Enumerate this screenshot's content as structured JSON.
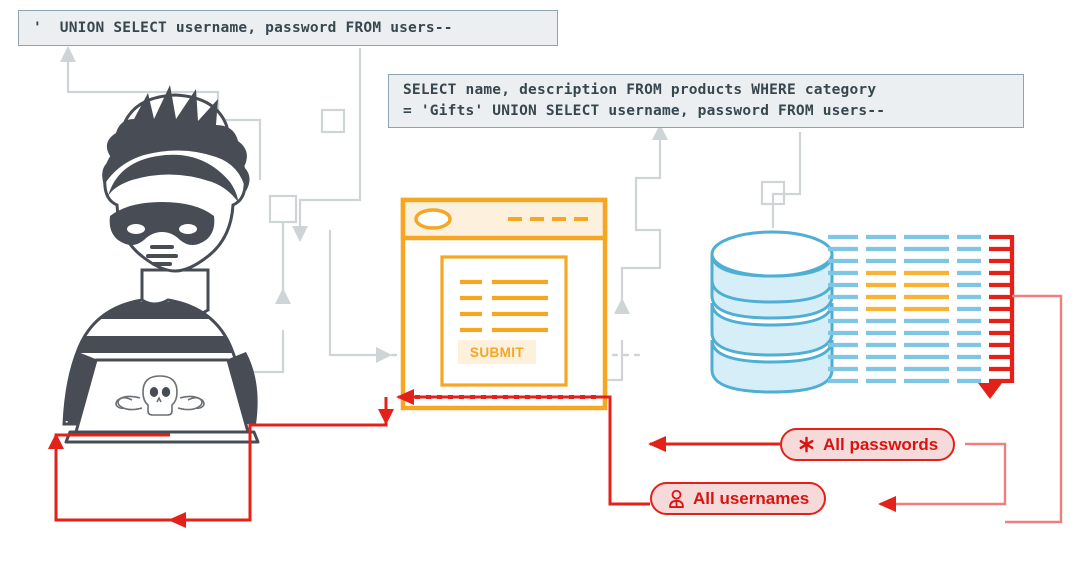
{
  "diagram": {
    "title": "SQL injection UNION attack flow",
    "colors": {
      "gray_path": "#cfd4d6",
      "red": "#e32119",
      "red_dark": "#d81410",
      "red_light": "#ef7f7c",
      "orange": "#f5a623",
      "orange_light": "#fdf0dd",
      "blue": "#4eaed4",
      "blue_light": "#d5eef7",
      "code_bg": "#eceff1",
      "code_border": "#90a4ae",
      "code_text": "#37474f",
      "figure_dark": "#474c55"
    }
  },
  "code_boxes": {
    "attack": {
      "label": "attacker-payload",
      "text": "'  UNION SELECT username, password FROM users--"
    },
    "query": {
      "label": "resulting-sql-query",
      "line1": "SELECT name, description FROM products WHERE category",
      "line2": "= 'Gifts' UNION SELECT username, password FROM users--"
    }
  },
  "actors": {
    "hacker": {
      "label": "attacker",
      "laptop_emblem": "skull-and-crossbones"
    },
    "browser": {
      "label": "vulnerable-web-application",
      "submit_label": "SUBMIT",
      "form_rows": 4,
      "titlebar_dashes": 5
    },
    "database": {
      "label": "database",
      "disks": 4
    }
  },
  "data_grid": {
    "rows": 13,
    "columns": 5,
    "highlight_rows": [
      3,
      4,
      5,
      6
    ],
    "highlight_columns": [
      1,
      2
    ],
    "normal_color": "#7ec6e4",
    "highlight_color": "#f9b233"
  },
  "badges": [
    {
      "id": "passwords",
      "icon": "asterisk-icon",
      "label": "All passwords"
    },
    {
      "id": "usernames",
      "icon": "person-icon",
      "label": "All usernames"
    }
  ]
}
